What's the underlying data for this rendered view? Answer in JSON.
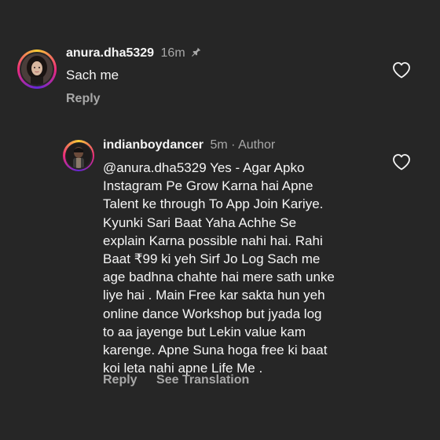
{
  "comment1": {
    "username": "anura.dha5329",
    "time": "16m",
    "text": "Sach me",
    "reply_label": "Reply"
  },
  "reply1": {
    "username": "indianboydancer",
    "time": "5m",
    "separator": "·",
    "author_badge": "Author",
    "lines": [
      "@anura.dha5329 Yes - Agar Apko",
      "Instagram Pe Grow Karna hai Apne",
      "Talent ke through To App Join Kariye.",
      "Kyunki Sari Baat Yaha Achhe Se",
      "explain Karna possible nahi hai. Rahi",
      "Baat ₹99 ki yeh Sirf Jo Log Sach me",
      "age badhna chahte hai mere sath unke",
      "liye hai . Main Free kar sakta hun yeh",
      "online dance Workshop but jyada log",
      "to aa jayenge but Lekin value kam",
      "karenge. Apne Suna hoga free ki baat",
      "koi leta nahi apne Life Me ."
    ],
    "reply_label": "Reply",
    "translation_label": "See Translation"
  },
  "icons": {
    "pin": "pin-icon",
    "heart": "heart-icon"
  },
  "colors": {
    "background": "#262626",
    "text_primary": "#f5f5f5",
    "text_secondary": "#a8a8a8"
  }
}
